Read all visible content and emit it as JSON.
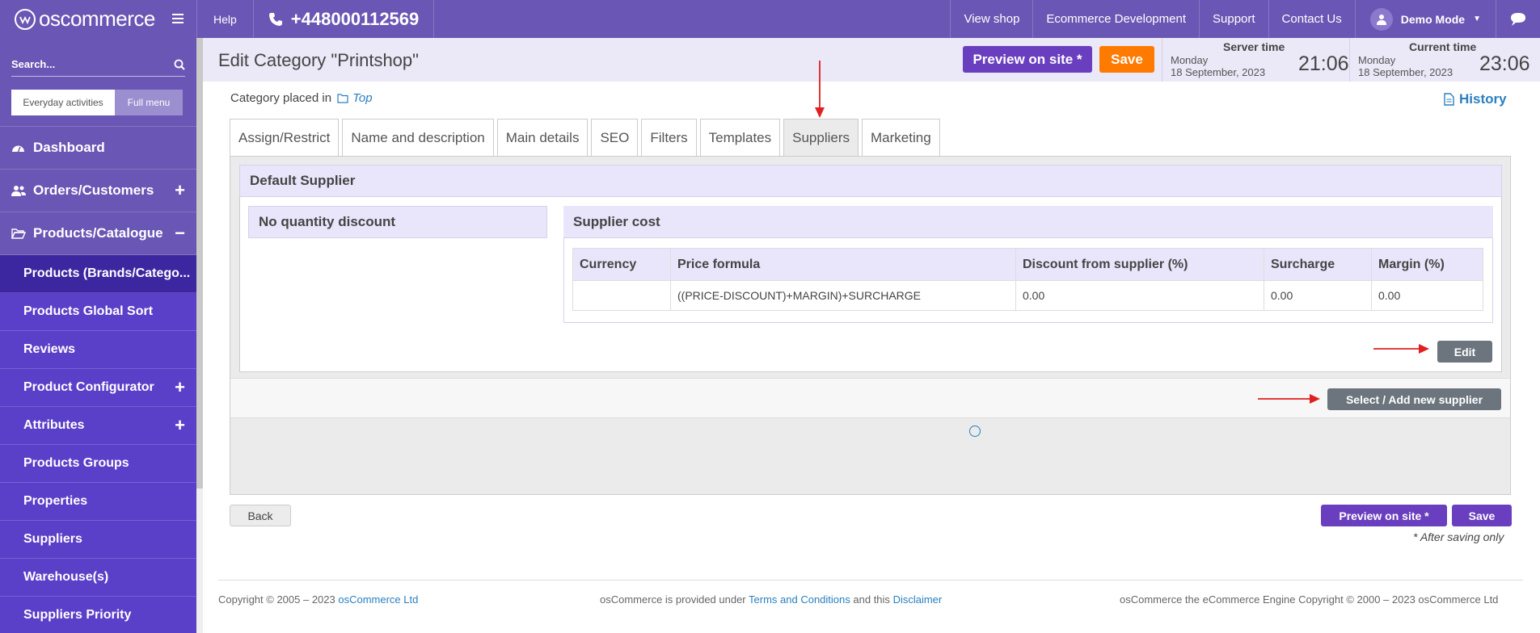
{
  "topbar": {
    "logo_text": "oscommerce",
    "help": "Help",
    "phone": "+448000112569",
    "links": [
      "View shop",
      "Ecommerce Development",
      "Support",
      "Contact Us"
    ],
    "user": "Demo Mode"
  },
  "sidebar": {
    "search_placeholder": "Search...",
    "toggle": {
      "everyday": "Everyday activities",
      "full": "Full menu"
    },
    "items": [
      {
        "label": "Dashboard"
      },
      {
        "label": "Orders/Customers"
      },
      {
        "label": "Products/Catalogue"
      },
      {
        "label": "Products (Brands/Catego..."
      },
      {
        "label": "Products Global Sort"
      },
      {
        "label": "Reviews"
      },
      {
        "label": "Product Configurator"
      },
      {
        "label": "Attributes"
      },
      {
        "label": "Products Groups"
      },
      {
        "label": "Properties"
      },
      {
        "label": "Suppliers"
      },
      {
        "label": "Warehouse(s)"
      },
      {
        "label": "Suppliers Priority"
      }
    ]
  },
  "header": {
    "title": "Edit Category \"Printshop\"",
    "preview": "Preview on site *",
    "save": "Save",
    "server_time": {
      "label": "Server time",
      "day": "Monday",
      "date": "18 September, 2023",
      "time": "21:06"
    },
    "current_time": {
      "label": "Current time",
      "day": "Monday",
      "date": "18 September, 2023",
      "time": "23:06"
    }
  },
  "breadcrumb": {
    "prefix": "Category placed in",
    "link": "Top"
  },
  "history": "History",
  "tabs": [
    "Assign/Restrict",
    "Name and description",
    "Main details",
    "SEO",
    "Filters",
    "Templates",
    "Suppliers",
    "Marketing"
  ],
  "suppliers": {
    "default_title": "Default Supplier",
    "no_discount": "No quantity discount",
    "cost_title": "Supplier cost",
    "columns": [
      "Currency",
      "Price formula",
      "Discount from supplier (%)",
      "Surcharge",
      "Margin (%)"
    ],
    "rows": [
      [
        "",
        "((PRICE-DISCOUNT)+MARGIN)+SURCHARGE",
        "0.00",
        "0.00",
        "0.00"
      ]
    ],
    "edit": "Edit",
    "select_add": "Select / Add new supplier"
  },
  "bottom": {
    "back": "Back",
    "preview": "Preview on site *",
    "save": "Save",
    "note": "* After saving only"
  },
  "footer": {
    "copyright": "Copyright © 2005 – 2023",
    "company": "osCommerce Ltd",
    "provided": "osCommerce is provided under",
    "terms": "Terms and Conditions",
    "and_this": "and this",
    "disclaimer": "Disclaimer",
    "engine": "osCommerce the eCommerce Engine Copyright © 2000 – 2023 osCommerce Ltd"
  },
  "colors": {
    "brand": "#6a56b4",
    "orange": "#ff7a00",
    "purple_button": "#6a3fbf",
    "link": "#2a7fc0"
  }
}
